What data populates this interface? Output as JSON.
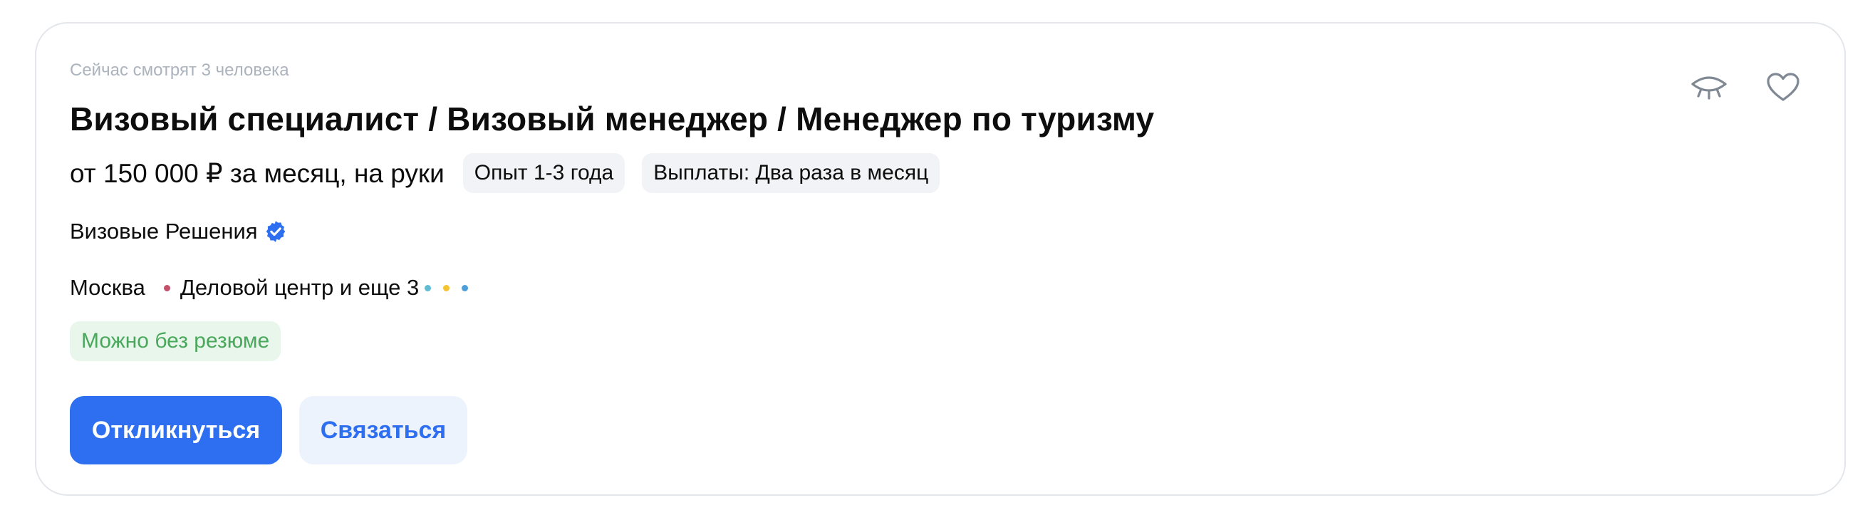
{
  "vacancy": {
    "viewers_text": "Сейчас смотрят 3 человека",
    "title": "Визовый специалист / Визовый менеджер / Менеджер по туризму",
    "salary": "от 150 000 ₽ за месяц, на руки",
    "tags": [
      {
        "label": "Опыт 1-3 года"
      },
      {
        "label": "Выплаты: Два раза в месяц"
      }
    ],
    "company": {
      "name": "Визовые Решения",
      "verified_icon": "verified-badge-icon"
    },
    "location": {
      "city": "Москва",
      "metro": "Деловой центр и еще 3",
      "metro_line_colors": [
        "#c2506b",
        "#5fbcd3",
        "#f5c431",
        "#4d9ed9"
      ]
    },
    "badge": "Можно без резюме",
    "actions": {
      "apply_label": "Откликнуться",
      "contact_label": "Связаться"
    },
    "icons": {
      "hide": "eye-closed-icon",
      "favorite": "heart-icon"
    }
  },
  "colors": {
    "accent": "#2e6ff2",
    "accent_light": "#edf3fd",
    "tag_background": "#f2f3f6",
    "badge_background": "#e9f6ec",
    "badge_text": "#49a85c",
    "muted_text": "#abb3bd",
    "border": "#e3e6ea"
  }
}
